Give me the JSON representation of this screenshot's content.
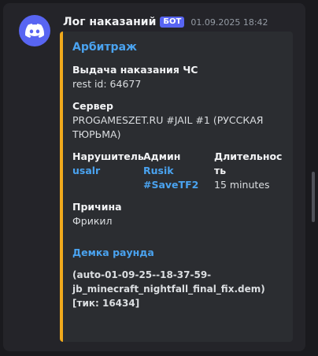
{
  "message": {
    "author": "Лог наказаний",
    "badge": "БОТ",
    "timestamp": "01.09.2025 18:42"
  },
  "embed": {
    "title": "Арбитраж",
    "accent_color": "#f0a91c",
    "action": "Выдача наказания ЧС",
    "rest_id": "rest id: 64677",
    "server_label": "Сервер",
    "server_value": "PROGAMESZET.RU #JAIL #1 (РУССКАЯ ТЮРЬМА)",
    "offender_label": "Нарушитель",
    "offender_value": "usalr",
    "admin_label": "Админ",
    "admin_line1": "Rusik",
    "admin_line2": "#SaveTF2",
    "duration_label": "Длительность",
    "duration_value": "15 minutes",
    "reason_label": "Причина",
    "reason_value": "Фрикил",
    "demo_title": "Демка раунда",
    "demo_line1": "(auto-01-09-25--18-37-59-",
    "demo_line2": "jb_minecraft_nightfall_final_fix.dem)",
    "demo_line3": "[тик: 16434]"
  },
  "icons": {
    "avatar": "discord-logo-icon"
  }
}
